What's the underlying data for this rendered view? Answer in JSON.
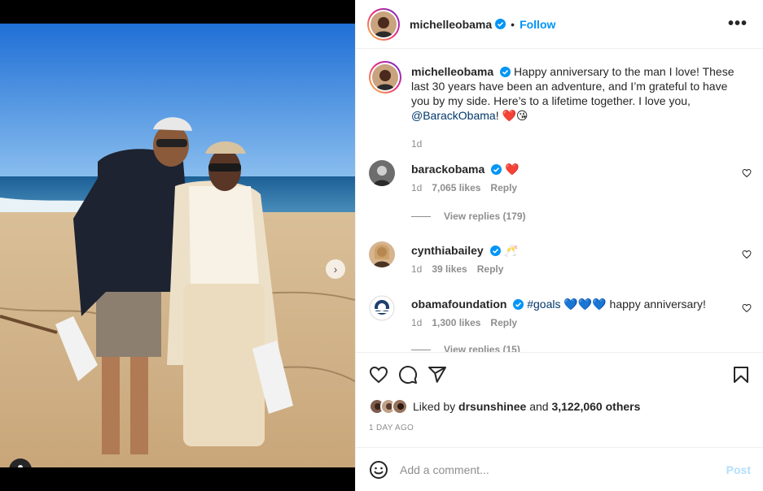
{
  "post": {
    "author": "michelleobama",
    "follow_label": "Follow",
    "separator": "•",
    "more_label": "•••",
    "caption_prefix": "Happy anniversary to the man I love! These last 30 years have been an adventure, and I’m grateful to have you by my side. Here’s to a lifetime together. I love you, ",
    "caption_mention": "@BarackObama",
    "caption_suffix": "! ❤️😘",
    "caption_time": "1d",
    "next_arrow": "›"
  },
  "comments": [
    {
      "user": "barackobama",
      "text": "❤️",
      "time": "1d",
      "likes": "7,065 likes",
      "reply": "Reply",
      "view_replies": "View replies (179)"
    },
    {
      "user": "cynthiabailey",
      "text": "🥂",
      "time": "1d",
      "likes": "39 likes",
      "reply": "Reply"
    },
    {
      "user": "obamafoundation",
      "hashtag": "#goals",
      "text": "💙💙💙 happy anniversary!",
      "time": "1d",
      "likes": "1,300 likes",
      "reply": "Reply",
      "view_replies": "View replies (15)"
    }
  ],
  "footer": {
    "liked_prefix": "Liked by",
    "liked_user": "drsunshinee",
    "liked_and": "and",
    "liked_count": "3,122,060 others",
    "posted": "1 DAY AGO",
    "comment_placeholder": "Add a comment...",
    "post_label": "Post"
  },
  "colors": {
    "accent": "#0095f6",
    "text": "#262626",
    "muted": "#8e8e8e",
    "heart": "#ed4956"
  }
}
